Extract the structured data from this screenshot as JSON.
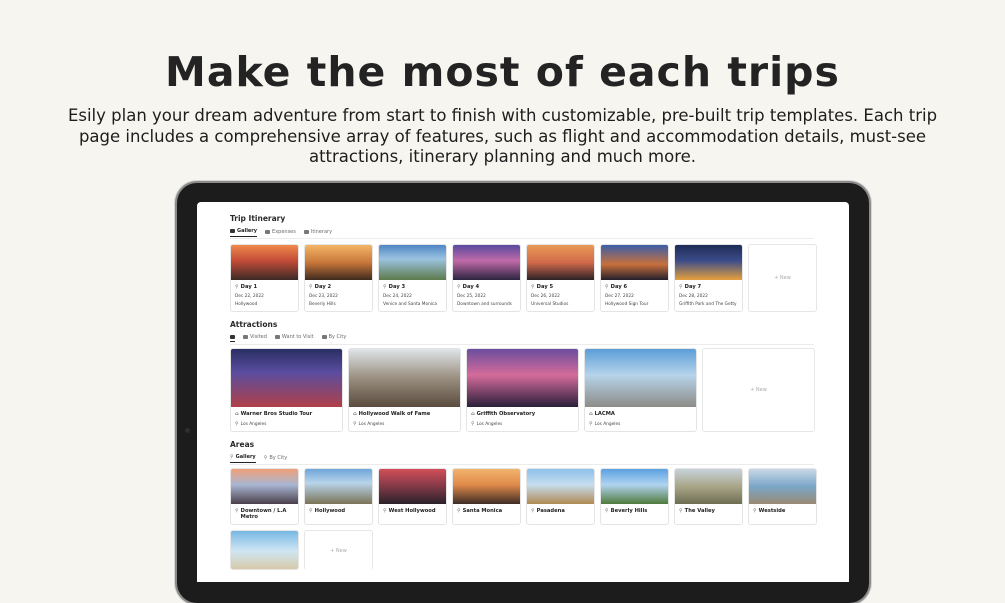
{
  "headline": "Make the most of each trips",
  "subtext": "Esily plan your dream adventure from start to finish with customizable, pre-built trip templates. Each trip page includes a comprehensive array of features, such as flight and accommodation details, must-see attractions, itinerary planning and much more.",
  "itinerary": {
    "title": "Trip Itinerary",
    "tabs": [
      "Gallery",
      "Expenses",
      "Itinerary"
    ],
    "cards": [
      {
        "day": "Day 1",
        "date": "Dec 22, 2022",
        "place": "Hollywood"
      },
      {
        "day": "Day 2",
        "date": "Dec 23, 2022",
        "place": "Beverly Hills"
      },
      {
        "day": "Day 3",
        "date": "Dec 24, 2022",
        "place": "Venice and Santa Monica"
      },
      {
        "day": "Day 4",
        "date": "Dec 25, 2022",
        "place": "Downtown and surrounds"
      },
      {
        "day": "Day 5",
        "date": "Dec 26, 2022",
        "place": "Universal Studios"
      },
      {
        "day": "Day 6",
        "date": "Dec 27, 2022",
        "place": "Hollywood Sign Tour"
      },
      {
        "day": "Day 7",
        "date": "Dec 28, 2022",
        "place": "Griffith Park and The Getty"
      }
    ],
    "new_label": "+ New"
  },
  "attractions": {
    "title": "Attractions",
    "tabs": [
      "",
      "Visited",
      "Want to Visit",
      "By City"
    ],
    "cards": [
      {
        "name": "Warner Bros Studio Tour",
        "city": "Los Angeles"
      },
      {
        "name": "Hollywood Walk of Fame",
        "city": "Los Angeles"
      },
      {
        "name": "Griffith Observatory",
        "city": "Los Angeles"
      },
      {
        "name": "LACMA",
        "city": "Los Angeles"
      }
    ],
    "new_label": "+ New"
  },
  "areas": {
    "title": "Areas",
    "tabs": [
      "Gallery",
      "By City"
    ],
    "cards": [
      {
        "name": "Downtown / L.A Metro"
      },
      {
        "name": "Hollywood"
      },
      {
        "name": "West Hollywood"
      },
      {
        "name": "Santa Monica"
      },
      {
        "name": "Pasadena"
      },
      {
        "name": "Beverly Hills"
      },
      {
        "name": "The Valley"
      },
      {
        "name": "Westside"
      }
    ],
    "new_label": "+ New"
  },
  "colors": {
    "page_bg": "#f7f5f0",
    "device": "#1c1c1c"
  }
}
